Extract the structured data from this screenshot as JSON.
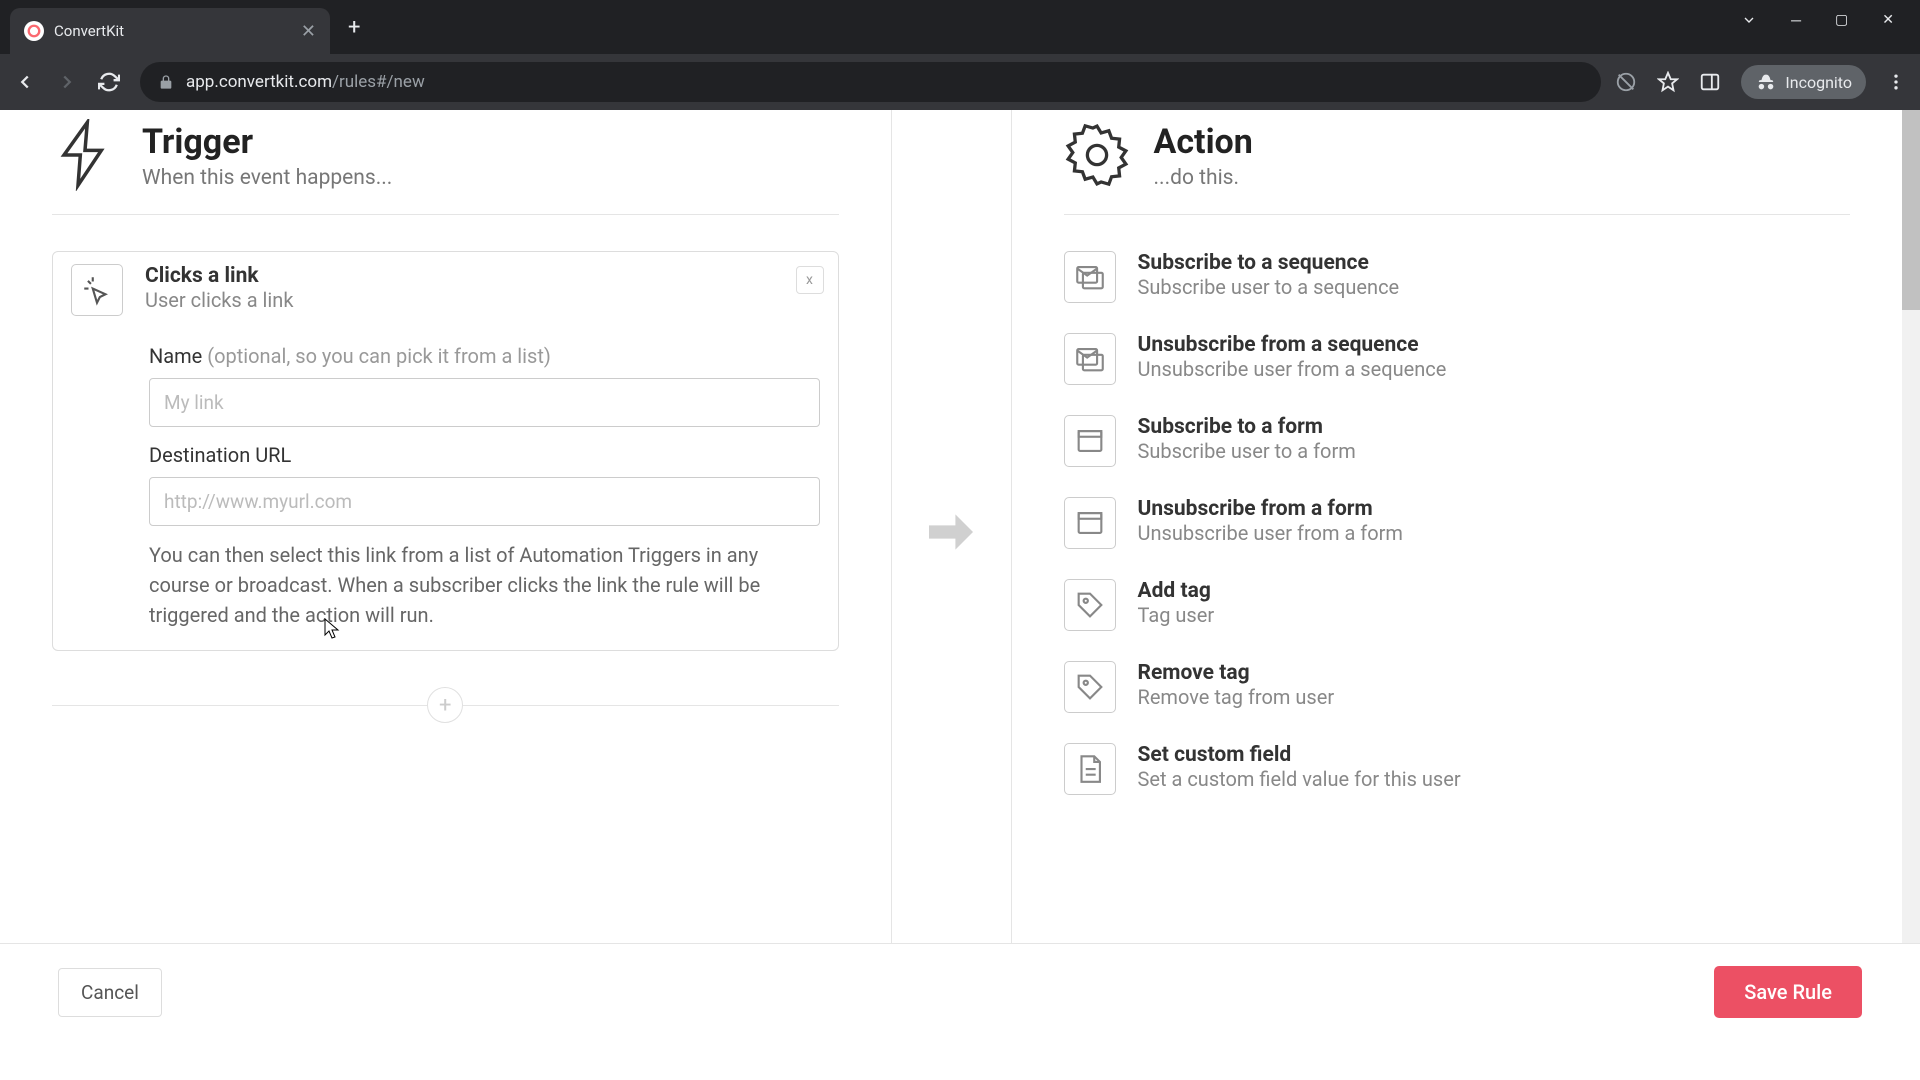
{
  "browser": {
    "tab_title": "ConvertKit",
    "url_domain": "app.convertkit.com",
    "url_path": "/rules#/new",
    "incognito_label": "Incognito"
  },
  "trigger": {
    "title": "Trigger",
    "subtitle": "When this event happens...",
    "selected": {
      "title": "Clicks a link",
      "subtitle": "User clicks a link",
      "close_label": "x"
    },
    "name_label": "Name",
    "name_hint": "(optional, so you can pick it from a list)",
    "name_placeholder": "My link",
    "url_label": "Destination URL",
    "url_placeholder": "http://www.myurl.com",
    "help_text": "You can then select this link from a list of Automation Triggers in any course or broadcast. When a subscriber clicks the link the rule will be triggered and the action will run."
  },
  "action": {
    "title": "Action",
    "subtitle": "...do this.",
    "items": [
      {
        "title": "Subscribe to a sequence",
        "subtitle": "Subscribe user to a sequence",
        "icon": "sequence"
      },
      {
        "title": "Unsubscribe from a sequence",
        "subtitle": "Unsubscribe user from a sequence",
        "icon": "sequence"
      },
      {
        "title": "Subscribe to a form",
        "subtitle": "Subscribe user to a form",
        "icon": "form"
      },
      {
        "title": "Unsubscribe from a form",
        "subtitle": "Unsubscribe user from a form",
        "icon": "form"
      },
      {
        "title": "Add tag",
        "subtitle": "Tag user",
        "icon": "tag"
      },
      {
        "title": "Remove tag",
        "subtitle": "Remove tag from user",
        "icon": "tag"
      },
      {
        "title": "Set custom field",
        "subtitle": "Set a custom field value for this user",
        "icon": "doc"
      }
    ]
  },
  "footer": {
    "cancel": "Cancel",
    "save": "Save Rule"
  }
}
